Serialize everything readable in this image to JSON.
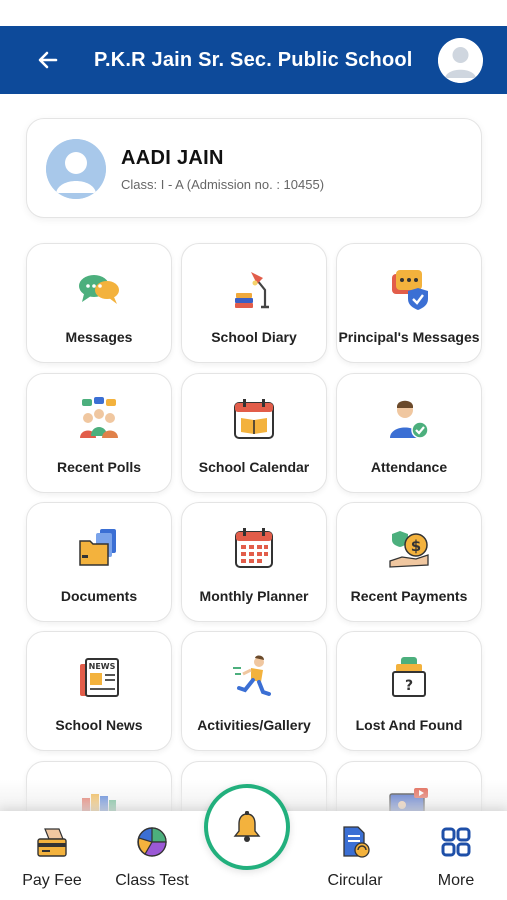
{
  "header": {
    "title": "P.K.R Jain Sr. Sec. Public School",
    "back_icon": "arrow-left-icon",
    "avatar_icon": "user-avatar-icon",
    "color": "#0d4a9a"
  },
  "profile": {
    "name": "AADI JAIN",
    "class_line": "Class: I - A (Admission no. : 10455)"
  },
  "tiles": [
    {
      "label": "Messages",
      "icon": "chat-bubbles-icon"
    },
    {
      "label": "School Diary",
      "icon": "desk-lamp-books-icon"
    },
    {
      "label": "Principal's Messages",
      "icon": "message-shield-icon"
    },
    {
      "label": "Recent Polls",
      "icon": "group-poll-icon"
    },
    {
      "label": "School Calendar",
      "icon": "calendar-book-icon"
    },
    {
      "label": "Attendance",
      "icon": "person-check-icon"
    },
    {
      "label": "Documents",
      "icon": "folders-icon"
    },
    {
      "label": "Monthly Planner",
      "icon": "calendar-grid-icon"
    },
    {
      "label": "Recent Payments",
      "icon": "hand-money-icon"
    },
    {
      "label": "School News",
      "icon": "newspaper-icon"
    },
    {
      "label": "Activities/Gallery",
      "icon": "running-kid-icon"
    },
    {
      "label": "Lost And Found",
      "icon": "lost-box-icon"
    },
    {
      "label": "",
      "icon": "books-icon"
    },
    {
      "label": "",
      "icon": "blank-tile"
    },
    {
      "label": "",
      "icon": "video-screen-icon"
    }
  ],
  "bottom_nav": {
    "items": [
      {
        "label": "Pay Fee",
        "icon": "pay-card-icon"
      },
      {
        "label": "Class Test",
        "icon": "pie-chart-icon"
      },
      {
        "label": "Circular",
        "icon": "circular-doc-icon"
      },
      {
        "label": "More",
        "icon": "grid-more-icon"
      }
    ],
    "center_icon": "bell-icon",
    "accent": "#22b07d"
  }
}
